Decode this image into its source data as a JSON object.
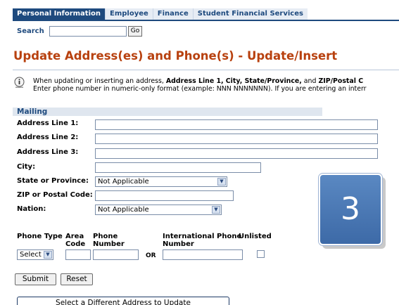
{
  "tabs": [
    "Personal Information",
    "Employee",
    "Finance",
    "Student Financial Services"
  ],
  "search": {
    "label": "Search",
    "value": "",
    "go_label": "Go"
  },
  "page_title": "Update Address(es) and Phone(s) - Update/Insert",
  "info": {
    "l1_a": "When updating or inserting an address, ",
    "l1_b": "Address Line 1, City, State/Province,",
    "l1_c": " and ",
    "l1_d": "ZIP/Postal C",
    "l2": "Enter phone number in numeric-only format (example: NNN NNNNNNN). If you are entering an interr"
  },
  "mailing": {
    "title": "Mailing",
    "address1_label": "Address Line 1:",
    "address2_label": "Address Line 2:",
    "address3_label": "Address Line 3:",
    "city_label": "City:",
    "state_label": "State or Province:",
    "state_value": "Not Applicable",
    "zip_label": "ZIP or Postal Code:",
    "nation_label": "Nation:",
    "nation_value": "Not Applicable"
  },
  "phone": {
    "type_head": "Phone Type",
    "area_head_1": "Area",
    "area_head_2": "Code",
    "phone_head_1": "Phone",
    "phone_head_2": "Number",
    "intl_head_1": "International Phone",
    "intl_head_2": "Number",
    "unlisted_head": "Unlisted",
    "type_value": "Select",
    "or_label": "OR"
  },
  "buttons": {
    "submit": "Submit",
    "reset": "Reset",
    "select_different": "Select a Different Address to Update"
  },
  "badge": {
    "number": "3"
  }
}
